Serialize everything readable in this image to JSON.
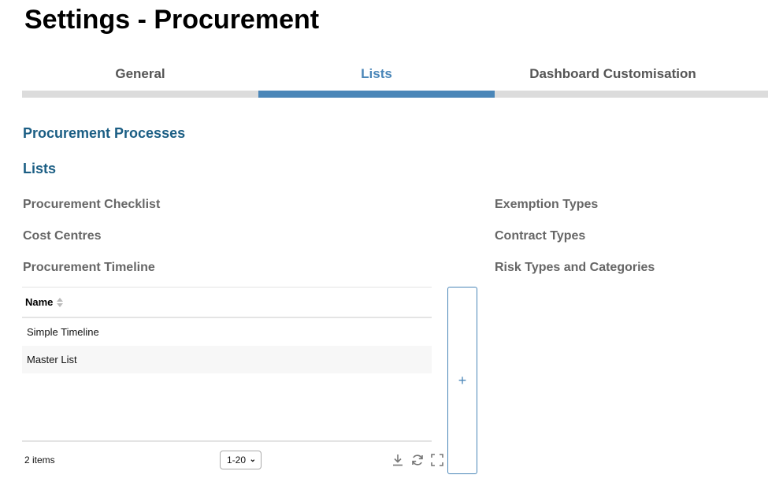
{
  "page": {
    "title": "Settings - Procurement"
  },
  "tabs": [
    {
      "label": "General",
      "active": false
    },
    {
      "label": "Lists",
      "active": true
    },
    {
      "label": "Dashboard Customisation",
      "active": false
    }
  ],
  "sections": {
    "procurement_processes": "Procurement Processes",
    "lists": "Lists"
  },
  "lists": {
    "left": [
      "Procurement Checklist",
      "Cost Centres",
      "Procurement Timeline"
    ],
    "right": [
      "Exemption Types",
      "Contract Types",
      "Risk Types and Categories"
    ]
  },
  "grid": {
    "column_name": "Name",
    "rows": [
      {
        "name": "Simple Timeline"
      },
      {
        "name": "Master List"
      }
    ],
    "item_count": "2 items",
    "page_size": "1-20"
  },
  "add_button": {
    "label": "+"
  },
  "colors": {
    "accent": "#4a86b8",
    "heading": "#1b5e84",
    "tab_inactive_bar": "#dcdcdc"
  },
  "icons": [
    "sort-icon",
    "download-icon",
    "refresh-icon",
    "fullscreen-icon",
    "plus-icon",
    "chevron-down-icon"
  ]
}
